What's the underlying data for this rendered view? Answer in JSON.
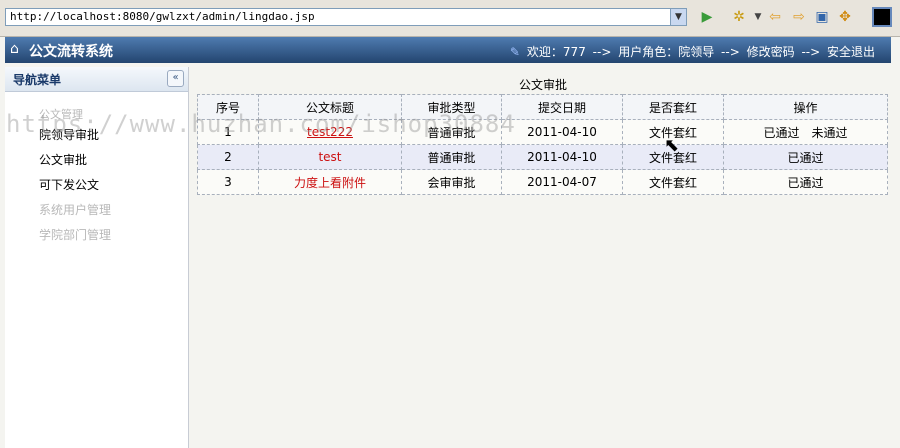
{
  "browser": {
    "url": "http://localhost:8080/gwlzxt/admin/lingdao.jsp"
  },
  "header": {
    "title": "公文流转系统",
    "welcome": "欢迎：777",
    "sep1": "-->",
    "role": "用户角色：院领导",
    "sep2": "-->",
    "change_password": "修改密码",
    "sep3": "-->",
    "logout": "安全退出"
  },
  "sidebar": {
    "title": "导航菜单",
    "collapse_glyph": "«",
    "items": [
      {
        "label": "公文管理"
      },
      {
        "label": "院领导审批"
      },
      {
        "label": "公文审批"
      },
      {
        "label": "可下发公文"
      },
      {
        "label": "系统用户管理"
      },
      {
        "label": "学院部门管理"
      }
    ]
  },
  "table": {
    "caption": "公文审批",
    "headers": [
      "序号",
      "公文标题",
      "审批类型",
      "提交日期",
      "是否套红",
      "操作"
    ],
    "rows": [
      {
        "no": "1",
        "title": "test222",
        "type": "普通审批",
        "date": "2011-04-10",
        "red": "文件套红",
        "op1": "已通过",
        "op2": "未通过"
      },
      {
        "no": "2",
        "title": "test",
        "type": "普通审批",
        "date": "2011-04-10",
        "red": "文件套红",
        "op1": "已通过",
        "op2": ""
      },
      {
        "no": "3",
        "title": "力度上看附件",
        "type": "会审审批",
        "date": "2011-04-07",
        "red": "文件套红",
        "op1": "已通过",
        "op2": ""
      }
    ]
  },
  "watermark": "https://www.huzhan.com/ishop30884"
}
